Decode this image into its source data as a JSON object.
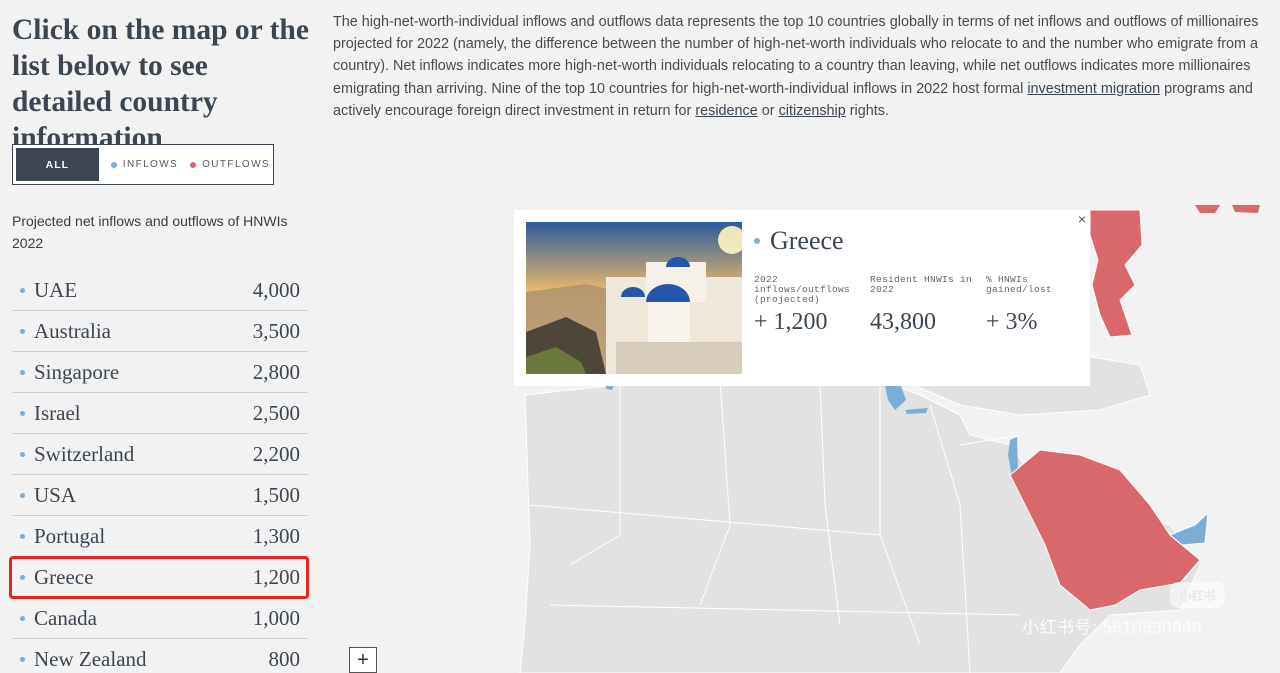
{
  "headline": "Click on the map or the list below to see detailed country information",
  "filter": {
    "all_label": "ALL",
    "inflows_label": "INFLOWS",
    "outflows_label": "OUTFLOWS",
    "active": "ALL",
    "colors": {
      "inflows": "#7aaed6",
      "outflows": "#d9686d",
      "active_bg": "#3b4652"
    }
  },
  "list_caption": "Projected net inflows and outflows of HNWIs 2022",
  "countries": [
    {
      "name": "UAE",
      "value": "4,000"
    },
    {
      "name": "Australia",
      "value": "3,500"
    },
    {
      "name": "Singapore",
      "value": "2,800"
    },
    {
      "name": "Israel",
      "value": "2,500"
    },
    {
      "name": "Switzerland",
      "value": "2,200"
    },
    {
      "name": "USA",
      "value": "1,500"
    },
    {
      "name": "Portugal",
      "value": "1,300"
    },
    {
      "name": "Greece",
      "value": "1,200"
    },
    {
      "name": "Canada",
      "value": "1,000"
    },
    {
      "name": "New Zealand",
      "value": "800"
    }
  ],
  "highlighted_country": "Greece",
  "intro": {
    "text_1": "The high-net-worth-individual inflows and outflows data represents the top 10 countries globally in terms of net inflows and outflows of millionaires projected for 2022 (namely, the difference between the number of high-net-worth individuals who relocate to and the number who emigrate from a country). Net inflows indicates more high-net-worth individuals relocating to a country than leaving, while net outflows indicates more millionaires emigrating than arriving. Nine of the top 10 countries for high-net-worth-individual inflows in 2022 host formal ",
    "link_1": "investment migration",
    "text_2": " programs and actively encourage foreign direct investment in return for ",
    "link_2": "residence",
    "text_3": " or ",
    "link_3": "citizenship",
    "text_4": " rights."
  },
  "popup": {
    "country": "Greece",
    "close": "×",
    "stats": [
      {
        "label": "2022 inflows/outflows (projected)",
        "value": "+ 1,200"
      },
      {
        "label": "Resident HNWIs in 2022",
        "value": "43,800"
      },
      {
        "label": "% HNWIs gained/lost",
        "value": "+ 3%"
      }
    ]
  },
  "map": {
    "colors": {
      "land": "#e2e2e2",
      "border": "#ffffff",
      "inflow": "#7aaed6",
      "outflow": "#d9686d"
    }
  },
  "zoom_in": "+",
  "watermark": {
    "badge": "小红书",
    "text": "小红书号: 5610830940"
  }
}
